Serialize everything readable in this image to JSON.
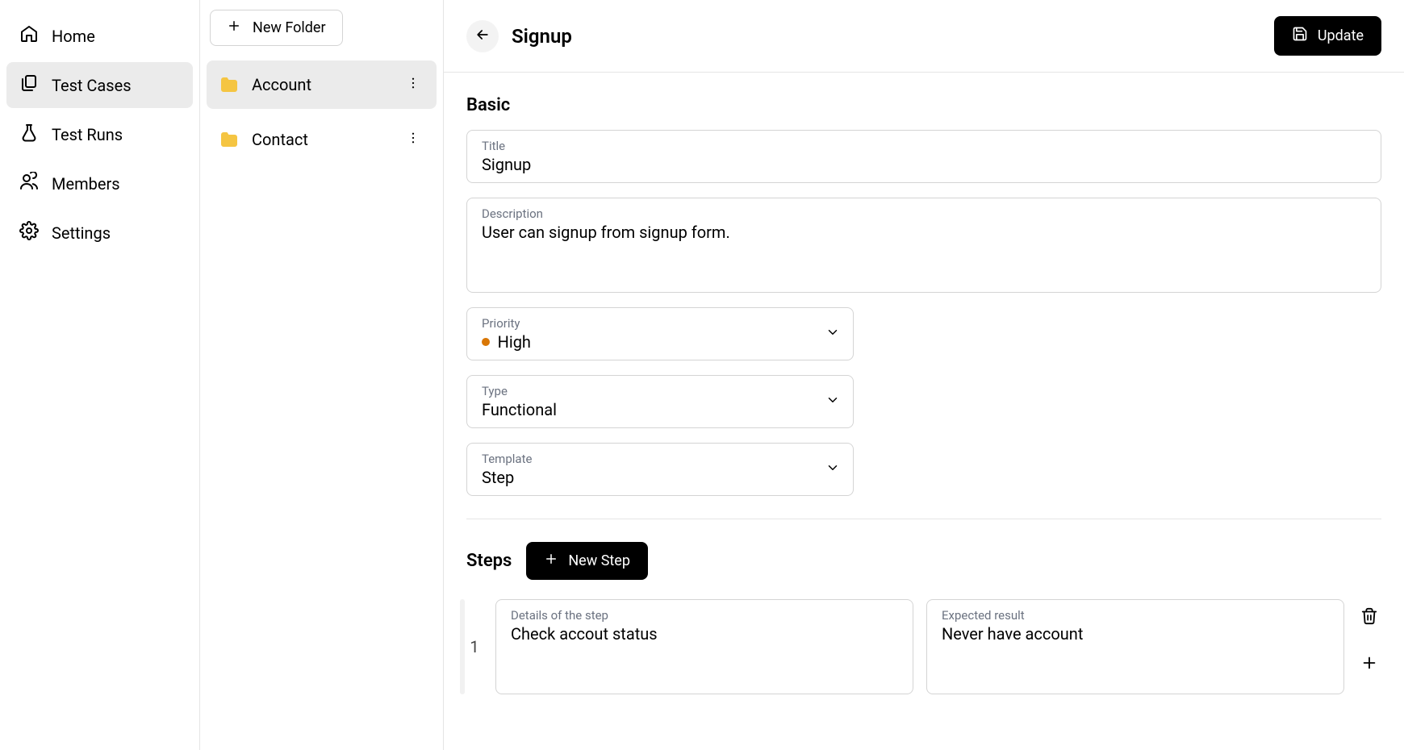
{
  "nav": {
    "items": [
      {
        "label": "Home"
      },
      {
        "label": "Test Cases"
      },
      {
        "label": "Test Runs"
      },
      {
        "label": "Members"
      },
      {
        "label": "Settings"
      }
    ]
  },
  "folderPanel": {
    "newFolderLabel": "New Folder",
    "folders": [
      {
        "label": "Account"
      },
      {
        "label": "Contact"
      }
    ]
  },
  "header": {
    "title": "Signup",
    "updateLabel": "Update"
  },
  "basic": {
    "sectionTitle": "Basic",
    "titleLabel": "Title",
    "titleValue": "Signup",
    "descLabel": "Description",
    "descValue": "User can signup from signup form.",
    "priorityLabel": "Priority",
    "priorityValue": "High",
    "typeLabel": "Type",
    "typeValue": "Functional",
    "templateLabel": "Template",
    "templateValue": "Step"
  },
  "steps": {
    "sectionTitle": "Steps",
    "newStepLabel": "New Step",
    "rows": [
      {
        "num": "1",
        "detailsLabel": "Details of the step",
        "detailsValue": "Check accout status",
        "expectedLabel": "Expected result",
        "expectedValue": "Never have account"
      }
    ]
  }
}
